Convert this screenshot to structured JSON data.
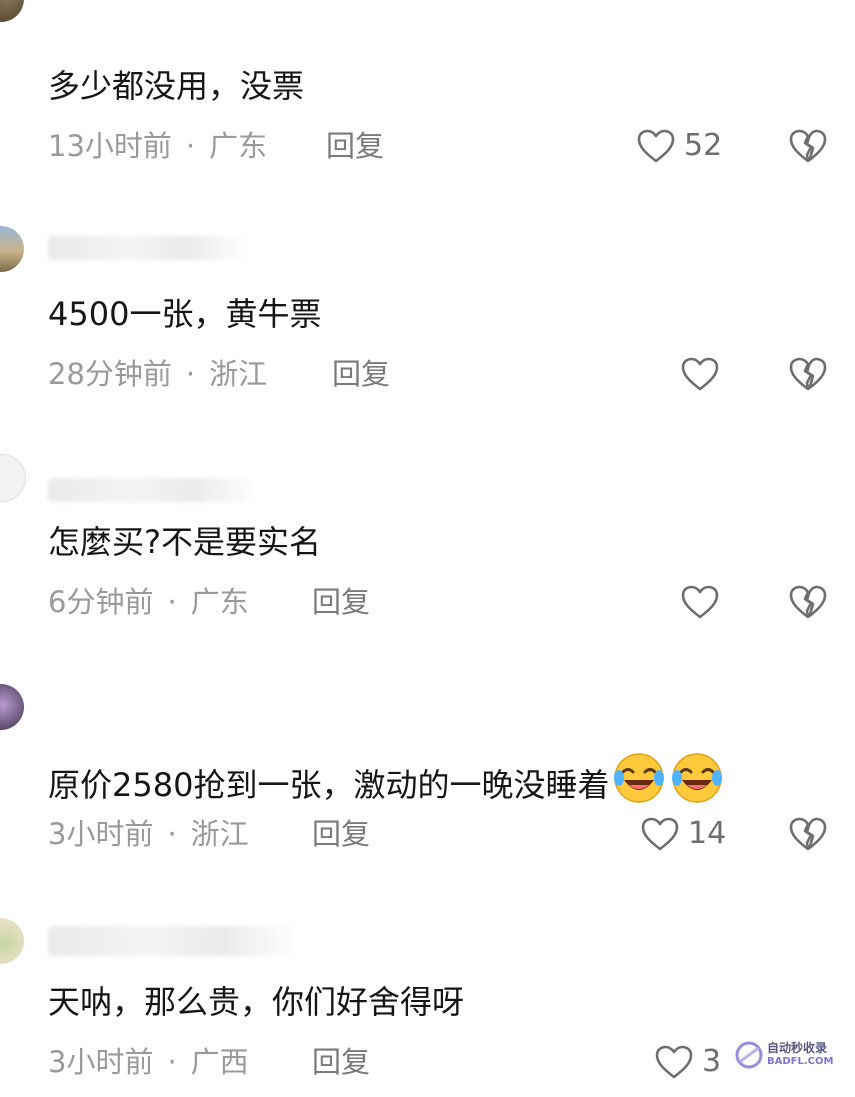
{
  "comments": [
    {
      "text": "多少都没用，没票",
      "time": "13小时前",
      "region": "广东",
      "reply_label": "回复",
      "likes": "52"
    },
    {
      "text": "4500一张，黄牛票",
      "time": "28分钟前",
      "region": "浙江",
      "reply_label": "回复",
      "likes": ""
    },
    {
      "text": "怎麼买?不是要实名",
      "time": "6分钟前",
      "region": "广东",
      "reply_label": "回复",
      "likes": ""
    },
    {
      "text": "原价2580抢到一张，激动的一晚没睡着",
      "time": "3小时前",
      "region": "浙江",
      "reply_label": "回复",
      "likes": "14",
      "emojis": [
        "laughing-crying-emoji",
        "laughing-crying-emoji"
      ]
    },
    {
      "text": "天呐，那么贵，你们好舍得呀",
      "time": "3小时前",
      "region": "广西",
      "reply_label": "回复",
      "likes": "3"
    }
  ],
  "separator": "·",
  "watermark": {
    "line1": "自动秒收录",
    "line2": "BADFL.COM"
  },
  "colors": {
    "meta": "#9a9a9a",
    "text": "#161616",
    "icon": "#6e6e6e"
  }
}
